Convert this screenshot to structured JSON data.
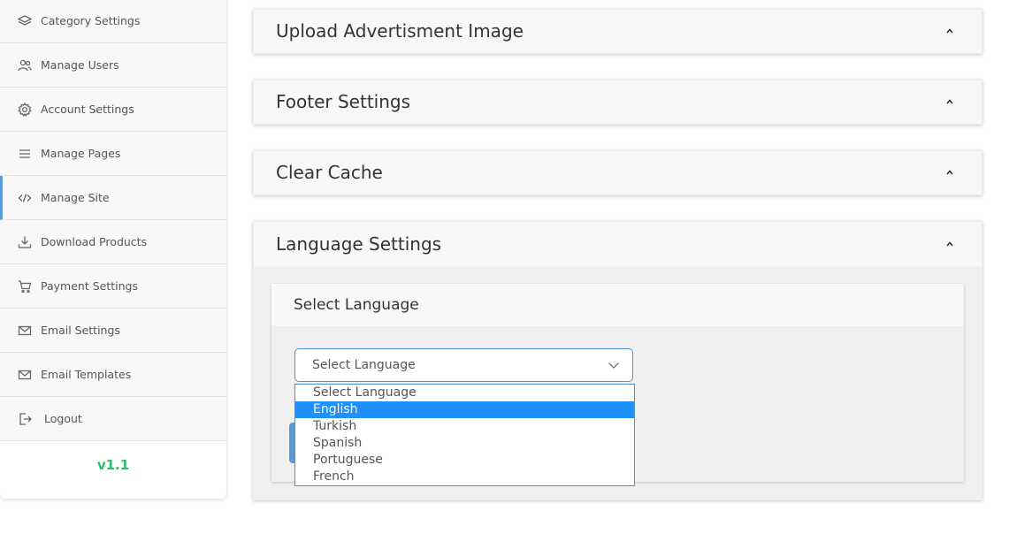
{
  "sidebar": {
    "items": [
      {
        "label": "Category Settings",
        "icon": "layers-icon"
      },
      {
        "label": "Manage Users",
        "icon": "users-icon"
      },
      {
        "label": "Account Settings",
        "icon": "gear-icon"
      },
      {
        "label": "Manage Pages",
        "icon": "menu-icon"
      },
      {
        "label": "Manage Site",
        "icon": "code-icon",
        "active": true
      },
      {
        "label": "Download Products",
        "icon": "download-icon"
      },
      {
        "label": "Payment Settings",
        "icon": "cart-icon"
      },
      {
        "label": "Email Settings",
        "icon": "mail-icon"
      },
      {
        "label": "Email Templates",
        "icon": "mail-icon"
      },
      {
        "label": "Logout",
        "icon": "logout-icon"
      }
    ],
    "version": "v1.1",
    "version_color": "#2dbb6c",
    "active_accent": "#5b9bd5"
  },
  "panels": {
    "upload_ad": {
      "title": "Upload Advertisment Image"
    },
    "footer": {
      "title": "Footer Settings"
    },
    "cache": {
      "title": "Clear Cache"
    },
    "language": {
      "title": "Language Settings",
      "card_title": "Select Language",
      "select": {
        "value": "Select Language",
        "options": [
          "Select Language",
          "English",
          "Turkish",
          "Spanish",
          "Portuguese",
          "French"
        ],
        "highlighted": "English"
      }
    }
  },
  "colors": {
    "highlight": "#1e90ff",
    "select_border": "#4a90d9"
  }
}
